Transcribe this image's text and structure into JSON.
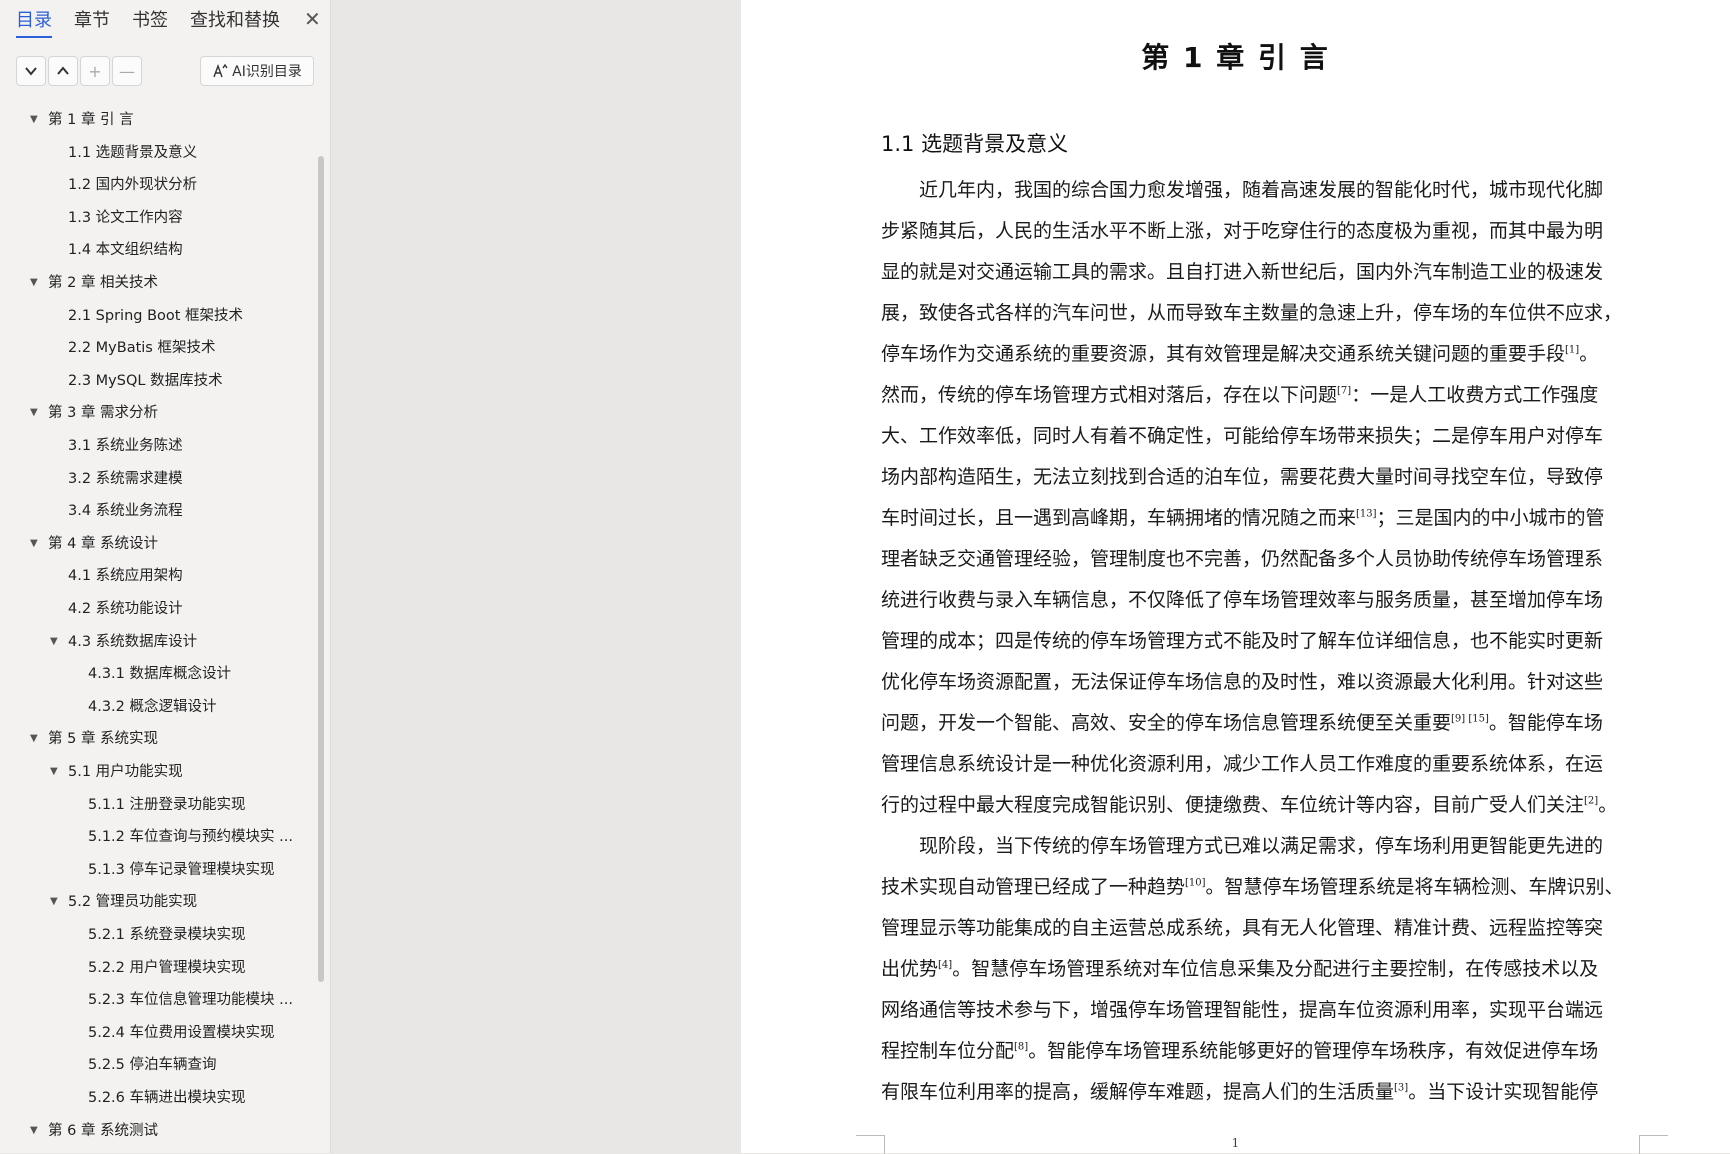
{
  "sidebar": {
    "tabs": [
      "目录",
      "章节",
      "书签",
      "查找和替换"
    ],
    "active_tab": "目录",
    "close_glyph": "✕",
    "tools": {
      "expand": "⌄",
      "collapse": "⌃",
      "add": "+",
      "remove": "—"
    },
    "ai_button": "AI识别目录",
    "toc": [
      {
        "label": "第 1 章  引  言",
        "level": 0,
        "expanded": true
      },
      {
        "label": "1.1  选题背景及意义",
        "level": 1
      },
      {
        "label": "1.2  国内外现状分析",
        "level": 1
      },
      {
        "label": "1.3  论文工作内容",
        "level": 1
      },
      {
        "label": "1.4  本文组织结构",
        "level": 1
      },
      {
        "label": "第 2 章  相关技术",
        "level": 0,
        "expanded": true
      },
      {
        "label": "2.1 Spring Boot  框架技术",
        "level": 1
      },
      {
        "label": "2.2 MyBatis 框架技术",
        "level": 1
      },
      {
        "label": "2.3 MySQL  数据库技术",
        "level": 1
      },
      {
        "label": "第 3 章  需求分析",
        "level": 0,
        "expanded": true
      },
      {
        "label": "3.1  系统业务陈述",
        "level": 1
      },
      {
        "label": "3.2  系统需求建模",
        "level": 1
      },
      {
        "label": "3.4  系统业务流程",
        "level": 1
      },
      {
        "label": "第 4 章  系统设计",
        "level": 0,
        "expanded": true
      },
      {
        "label": "4.1  系统应用架构",
        "level": 1
      },
      {
        "label": "4.2  系统功能设计",
        "level": 1
      },
      {
        "label": "4.3  系统数据库设计",
        "level": 1,
        "expanded": true
      },
      {
        "label": "4.3.1  数据库概念设计",
        "level": 2
      },
      {
        "label": "4.3.2  概念逻辑设计",
        "level": 2
      },
      {
        "label": "第 5 章  系统实现",
        "level": 0,
        "expanded": true
      },
      {
        "label": "5.1  用户功能实现",
        "level": 1,
        "expanded": true
      },
      {
        "label": "5.1.1  注册登录功能实现",
        "level": 2
      },
      {
        "label": "5.1.2  车位查询与预约模块实 ...",
        "level": 2
      },
      {
        "label": "5.1.3  停车记录管理模块实现",
        "level": 2
      },
      {
        "label": "5.2  管理员功能实现",
        "level": 1,
        "expanded": true
      },
      {
        "label": "5.2.1  系统登录模块实现",
        "level": 2
      },
      {
        "label": "5.2.2  用户管理模块实现",
        "level": 2
      },
      {
        "label": "5.2.3 车位信息管理功能模块 ...",
        "level": 2
      },
      {
        "label": "5.2.4 车位费用设置模块实现",
        "level": 2
      },
      {
        "label": "5.2.5 停泊车辆查询",
        "level": 2
      },
      {
        "label": "5.2.6 车辆进出模块实现",
        "level": 2
      },
      {
        "label": "第 6 章  系统测试",
        "level": 0,
        "expanded": true
      }
    ]
  },
  "document": {
    "chapter_title": "第 1 章  引  言",
    "section_title": "1.1  选题背景及意义",
    "lines": [
      {
        "t": "近几年内，我国的综合国力愈发增强，随着高速发展的智能化时代，城市现代化脚",
        "indent": true
      },
      {
        "t": "步紧随其后，人民的生活水平不断上涨，对于吃穿住行的态度极为重视，而其中最为明"
      },
      {
        "t": "显的就是对交通运输工具的需求。且自打进入新世纪后，国内外汽车制造工业的极速发"
      },
      {
        "t": "展，致使各式各样的汽车问世，从而导致车主数量的急速上升，停车场的车位供不应求，"
      },
      {
        "t": "停车场作为交通系统的重要资源，其有效管理是解决交通系统关键问题的重要手段",
        "sup": "[1]",
        "after": "。"
      },
      {
        "t": "然而，传统的停车场管理方式相对落后，存在以下问题",
        "sup": "[7]",
        "after": "：一是人工收费方式工作强度"
      },
      {
        "t": "大、工作效率低，同时人有着不确定性，可能给停车场带来损失；二是停车用户对停车"
      },
      {
        "t": "场内部构造陌生，无法立刻找到合适的泊车位，需要花费大量时间寻找空车位，导致停"
      },
      {
        "t": "车时间过长，且一遇到高峰期，车辆拥堵的情况随之而来",
        "sup": "[13]",
        "after": "；三是国内的中小城市的管"
      },
      {
        "t": "理者缺乏交通管理经验，管理制度也不完善，仍然配备多个人员协助传统停车场管理系"
      },
      {
        "t": "统进行收费与录入车辆信息，不仅降低了停车场管理效率与服务质量，甚至增加停车场"
      },
      {
        "t": "管理的成本；四是传统的停车场管理方式不能及时了解车位详细信息，也不能实时更新"
      },
      {
        "t": "优化停车场资源配置，无法保证停车场信息的及时性，难以资源最大化利用。针对这些"
      },
      {
        "t": "问题，开发一个智能、高效、安全的停车场信息管理系统便至关重要",
        "sup": "[9] [15]",
        "after": "。智能停车场"
      },
      {
        "t": "管理信息系统设计是一种优化资源利用，减少工作人员工作难度的重要系统体系，在运"
      },
      {
        "t": "行的过程中最大程度完成智能识别、便捷缴费、车位统计等内容，目前广受人们关注",
        "sup": "[2]",
        "after": "。"
      },
      {
        "t": "现阶段，当下传统的停车场管理方式已难以满足需求，停车场利用更智能更先进的",
        "indent": true
      },
      {
        "t": "技术实现自动管理已经成了一种趋势",
        "sup": "[10]",
        "after": "。智慧停车场管理系统是将车辆检测、车牌识别、"
      },
      {
        "t": "管理显示等功能集成的自主运营总成系统，具有无人化管理、精准计费、远程监控等突"
      },
      {
        "t": "出优势",
        "sup": "[4]",
        "after": "。智慧停车场管理系统对车位信息采集及分配进行主要控制，在传感技术以及"
      },
      {
        "t": "网络通信等技术参与下，增强停车场管理智能性，提高车位资源利用率，实现平台端远"
      },
      {
        "t": "程控制车位分配",
        "sup": "[8]",
        "after": "。智能停车场管理系统能够更好的管理停车场秩序，有效促进停车场"
      },
      {
        "t": "有限车位利用率的提高，缓解停车难题，提高人们的生活质量",
        "sup": "[3]",
        "after": "。当下设计实现智能停"
      }
    ],
    "page_number": "1"
  }
}
